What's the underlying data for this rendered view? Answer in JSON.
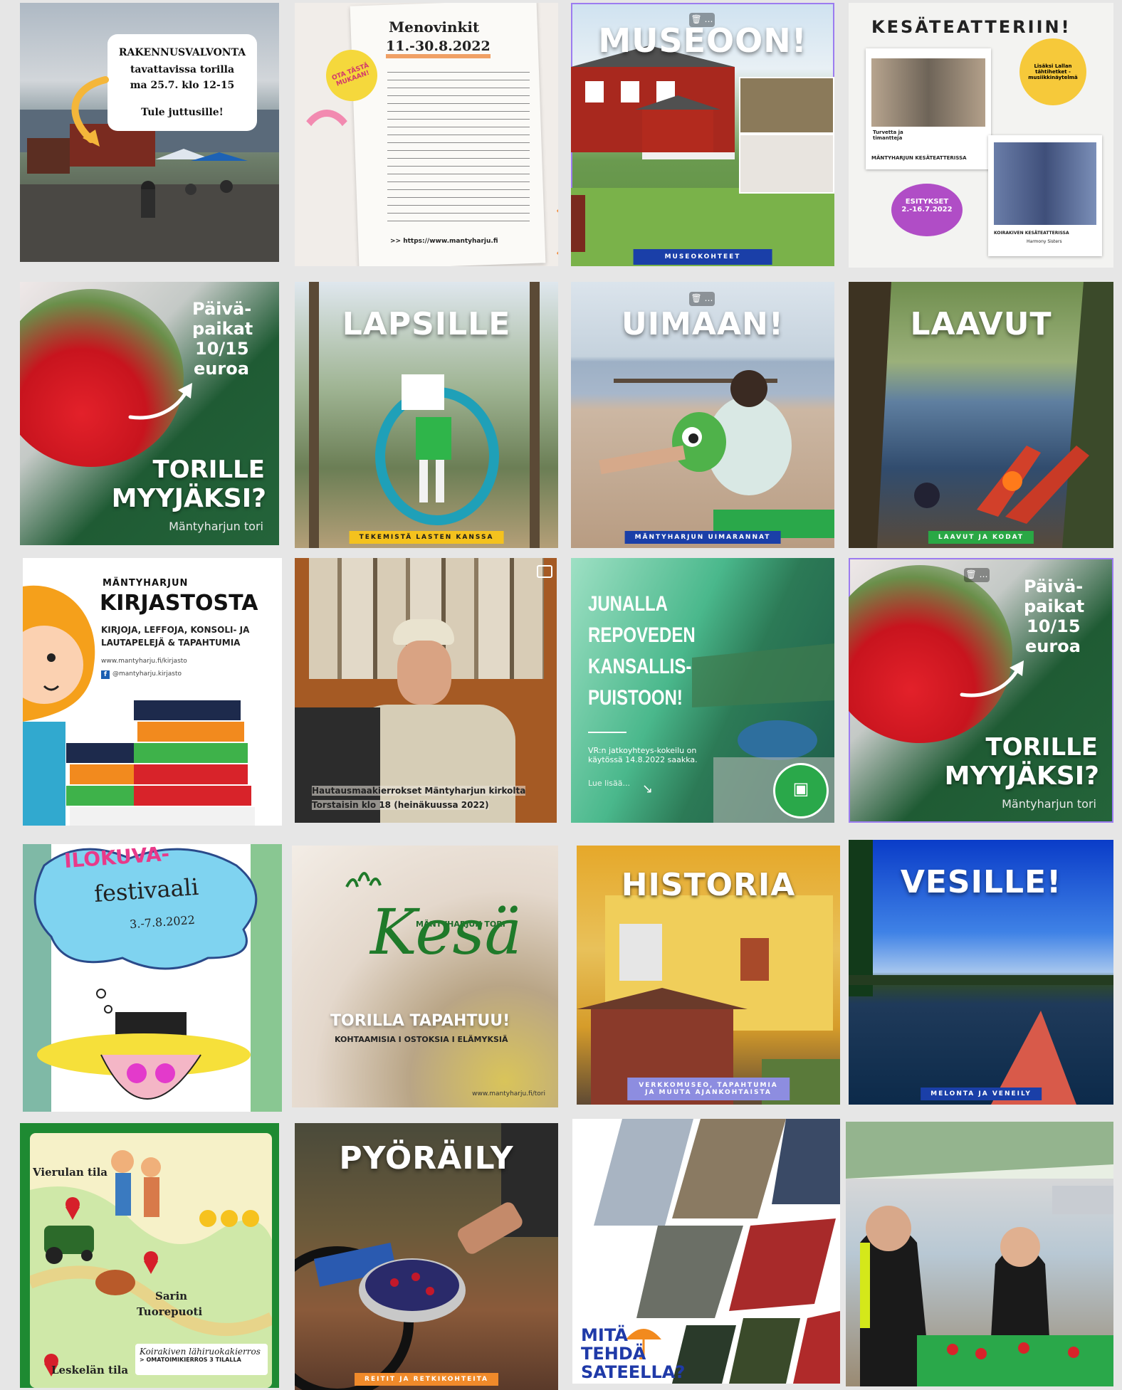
{
  "tiles": {
    "rakennus": {
      "line1": "RAKENNUSVALVONTA",
      "line2": "tavattavissa torilla",
      "line3": "ma 25.7. klo 12-15",
      "line4": "Tule juttusille!"
    },
    "menovinkit": {
      "title": "Menovinkit",
      "dates": "11.-30.8.2022",
      "sticker": "OTA TÄSTÄ MUKAAN!",
      "url": ">> https://www.mantyharju.fi"
    },
    "museoon": {
      "title": "MUSEOON!",
      "bar": "MUSEOKOHTEET"
    },
    "kesateatteri": {
      "title": "KESÄTEATTERIIN!",
      "bubble": "Lisäksi Lallan tähtihetket -musiikkinäytelmä",
      "caption1": "Turvetta ja timantteja",
      "label1": "MÄNTYHARJUN KESÄTEATTERISSA",
      "circle_l1": "ESITYKSET",
      "circle_l2": "2.-16.7.2022",
      "label2": "KOIRAKIVEN KESÄTEATTERISSA",
      "label2b": "Harmony Sisters"
    },
    "paiva1": {
      "l1": "Päivä-",
      "l2": "paikat",
      "l3": "10/15",
      "l4": "euroa",
      "big1": "TORILLE",
      "big2": "MYYJÄKSI?",
      "sub": "Mäntyharjun tori"
    },
    "lapsille": {
      "title": "LAPSILLE",
      "bar": "TEKEMISTÄ LASTEN KANSSA"
    },
    "uimaan": {
      "title": "UIMAAN!",
      "bar": "MÄNTYHARJUN UIMARANNAT"
    },
    "laavut": {
      "title": "LAAVUT",
      "bar": "LAAVUT JA KODAT"
    },
    "kirjasto": {
      "small": "MÄNTYHARJUN",
      "title": "KIRJASTOSTA",
      "sub1": "KIRJOJA, LEFFOJA, KONSOLI- JA",
      "sub2": "LAUTAPELEJÄ & TAPAHTUMIA",
      "url": "www.mantyharju.fi/kirjasto",
      "fb": "@mantyharju.kirjasto"
    },
    "hautaus": {
      "cap1": "Hautausmaakierrokset Mäntyharjun kirkolta",
      "cap2": "Torstaisin klo 18 (heinäkuussa 2022)"
    },
    "junalla": {
      "l1": "JUNALLA",
      "l2": "REPOVEDEN",
      "l3": "KANSALLIS-",
      "l4": "PUISTOON!",
      "body": "VR:n jatkoyhteys-kokeilu on käytössä 14.8.2022 saakka.",
      "more": "Lue lisää..."
    },
    "paiva2": {
      "l1": "Päivä-",
      "l2": "paikat",
      "l3": "10/15",
      "l4": "euroa",
      "big1": "TORILLE",
      "big2": "MYYJÄKSI?",
      "sub": "Mäntyharjun tori"
    },
    "ilokuva": {
      "title": "ILOKUVA-",
      "sub": "festivaali",
      "dates": "3.-7.8.2022"
    },
    "kesa": {
      "small": "MÄNTYHARJUN TORI",
      "script": "Kesä",
      "head": "TORILLA TAPAHTUU!",
      "sub": "KOHTAAMISIA I OSTOKSIA I ELÄMYKSIÄ",
      "url": "www.mantyharju.fi/tori"
    },
    "historia": {
      "title": "HISTORIA",
      "bar1": "VERKKOMUSEO, TAPAHTUMIA",
      "bar2": "JA MUUTA AJANKOHTAISTA"
    },
    "vesille": {
      "title": "VESILLE!",
      "bar": "MELONTA JA VENEILY"
    },
    "lahiruoka": {
      "p1": "Vierulan tila",
      "p2": "Sarin",
      "p2b": "Tuorepuoti",
      "p3": "Leskelän tila",
      "script": "Koirakiven lähiruokakierros",
      "sub": "> OMATOIMIKIERROS 3 TILALLA"
    },
    "pyoraily": {
      "title": "PYÖRÄILY",
      "bar": "REITIT JA RETKIKOHTEITA"
    },
    "sateella": {
      "l1": "MITÄ",
      "l2": "TEHDÄ",
      "l3": "SATEELLA?"
    },
    "tori": {}
  },
  "colors": {
    "page_bg": "#e6e6e6",
    "bar_blue": "#1a3fa8",
    "bar_yellow": "#f4c21e",
    "bar_green": "#2aa845",
    "green_dark": "#1f7a2a"
  }
}
